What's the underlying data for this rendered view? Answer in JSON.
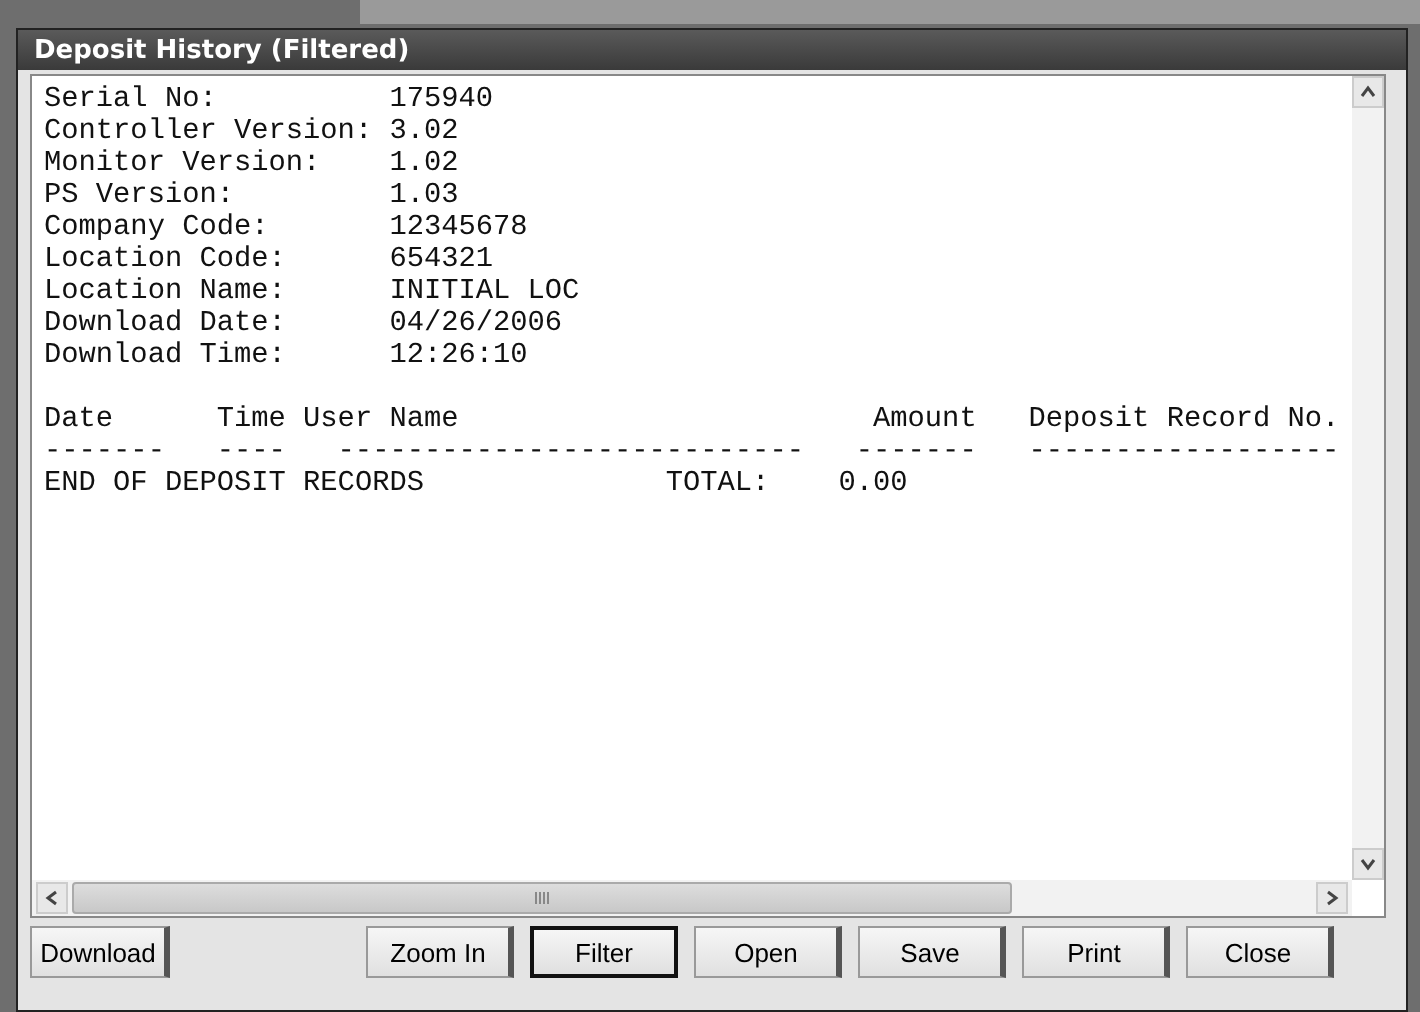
{
  "window": {
    "title": "Deposit History (Filtered)"
  },
  "info": [
    {
      "label": "Serial No:",
      "value": "175940"
    },
    {
      "label": "Controller Version:",
      "value": "3.02"
    },
    {
      "label": "Monitor Version:",
      "value": "1.02"
    },
    {
      "label": "PS Version:",
      "value": "1.03"
    },
    {
      "label": "Company Code:",
      "value": "12345678"
    },
    {
      "label": "Location Code:",
      "value": "654321"
    },
    {
      "label": "Location Name:",
      "value": "INITIAL LOC"
    },
    {
      "label": "Download Date:",
      "value": "04/26/2006"
    },
    {
      "label": "Download Time:",
      "value": "12:26:10"
    }
  ],
  "table": {
    "columns": [
      "Date",
      "Time",
      "User Name",
      "Amount",
      "Deposit Record No."
    ],
    "separators": [
      "-------",
      "----",
      "---------------------------",
      "-------",
      "------------------"
    ],
    "footer": [
      "END OF DEPOSIT RECORDS",
      "TOTAL:",
      "0.00"
    ]
  },
  "buttons": [
    {
      "label": "Download",
      "default": false
    },
    {
      "label": "Zoom In",
      "default": false
    },
    {
      "label": "Filter",
      "default": true
    },
    {
      "label": "Open",
      "default": false
    },
    {
      "label": "Save",
      "default": false
    },
    {
      "label": "Print",
      "default": false
    },
    {
      "label": "Close",
      "default": false
    }
  ]
}
